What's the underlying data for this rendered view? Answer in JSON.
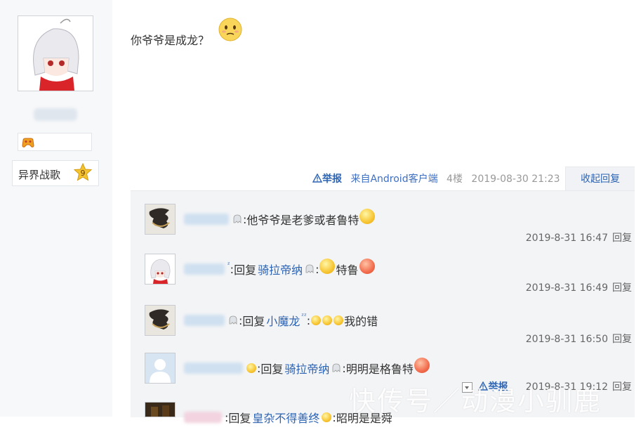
{
  "sidebar": {
    "level_name": "异界战歌",
    "level_number": "9"
  },
  "post": {
    "text": "你爷爷是成龙？",
    "report_label": "举报",
    "device": "来自Android客户端",
    "floor": "4楼",
    "timestamp": "2019-08-30 21:23",
    "collapse_label": "收起回复"
  },
  "replies": [
    {
      "prefix": ": ",
      "reply_word": "",
      "target": "",
      "content": "他爷爷是老爹或者鲁特",
      "time": "2019-8-31 16:47",
      "reply_label": "回复"
    },
    {
      "prefix": ": ",
      "reply_word": "回复",
      "target": "骑拉帝纳",
      "content": "特鲁",
      "time": "2019-8-31 16:49",
      "reply_label": "回复"
    },
    {
      "prefix": ": ",
      "reply_word": "回复",
      "target": "小魔龙",
      "content": "我的错",
      "time": "2019-8-31 16:50",
      "reply_label": "回复"
    },
    {
      "prefix": ": ",
      "reply_word": "回复",
      "target": "骑拉帝纳",
      "content": "明明是格鲁特",
      "time": "2019-8-31 19:12",
      "reply_label": "回复"
    },
    {
      "prefix": ": ",
      "reply_word": "回复",
      "target": "皇杂不得善终",
      "content": "昭明是是舜",
      "time": "",
      "reply_label": ""
    }
  ],
  "extra": {
    "report_label": "举报"
  },
  "watermark": "快传号／动漫小驯鹿",
  "colors": {
    "link": "#2d64b3",
    "meta": "#999999",
    "reply_bg": "#f3f4f6"
  }
}
